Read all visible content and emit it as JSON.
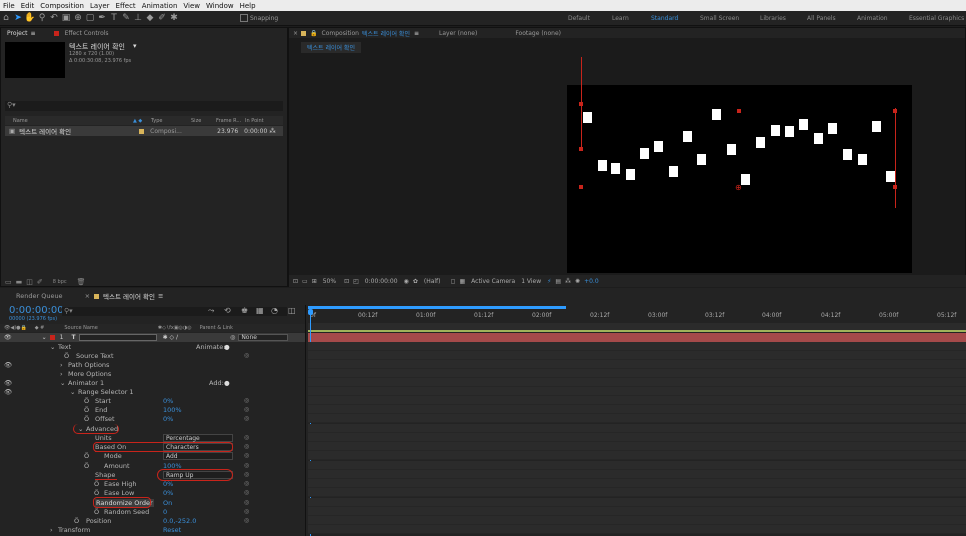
{
  "menu": [
    "File",
    "Edit",
    "Composition",
    "Layer",
    "Effect",
    "Animation",
    "View",
    "Window",
    "Help"
  ],
  "toolbar": {
    "snapping": "Snapping"
  },
  "workspaces": [
    "Default",
    "Learn",
    "Standard",
    "Small Screen",
    "Libraries",
    "All Panels",
    "Animation",
    "Essential Graphics"
  ],
  "project": {
    "tab": "Project",
    "effect_tab": "Effect Controls",
    "comp_name": "텍스트 레이어 확인",
    "comp_size": "1280 x 720 (1.00)",
    "comp_dur": "Δ 0:00:30:08, 23.976 fps",
    "cols": [
      "Name",
      "Type",
      "Size",
      "Frame R...",
      "In Point"
    ],
    "item": {
      "name": "텍스트 레이어 확인",
      "type": "Composi...",
      "fps": "23.976",
      "in": "0:00:00"
    },
    "bpc": "8 bpc"
  },
  "viewer": {
    "tab_prefix": "Composition",
    "tab_name": "텍스트 레이어 확인",
    "layer_tab": "Layer (none)",
    "footage_tab": "Footage (none)",
    "crumb": "텍스트 레이어 확인",
    "zoom": "50%",
    "time": "0:00:00:00",
    "res": "(Half)",
    "camera": "Active Camera",
    "views": "1 View",
    "exposure": "+0.0"
  },
  "timeline": {
    "render_queue": "Render Queue",
    "comp_tab": "텍스트 레이어 확인",
    "time": "0:00:00:00",
    "frames": "00000 (23.976 fps)",
    "search": "",
    "col_source": "Source Name",
    "col_parent": "Parent & Link",
    "layer_num": "1",
    "parent": "None",
    "ruler": [
      "0f",
      "00:12f",
      "01:00f",
      "01:12f",
      "02:00f",
      "02:12f",
      "03:00f",
      "03:12f",
      "04:00f",
      "04:12f",
      "05:00f",
      "05:12f"
    ],
    "props": {
      "text": "Text",
      "animate": "Animate:",
      "source_text": "Source Text",
      "path_options": "Path Options",
      "more_options": "More Options",
      "animator": "Animator 1",
      "add": "Add:",
      "range_selector": "Range Selector 1",
      "start": "Start",
      "start_v": "0%",
      "end": "End",
      "end_v": "100%",
      "offset": "Offset",
      "offset_v": "0%",
      "advanced": "Advanced",
      "units": "Units",
      "units_v": "Percentage",
      "based_on": "Based On",
      "based_on_v": "Characters",
      "mode": "Mode",
      "mode_v": "Add",
      "amount": "Amount",
      "amount_v": "100%",
      "shape": "Shape",
      "shape_v": "Ramp Up",
      "ease_high": "Ease High",
      "ease_high_v": "0%",
      "ease_low": "Ease Low",
      "ease_low_v": "0%",
      "randomize": "Randomize Order",
      "randomize_v": "On",
      "random_seed": "Random Seed",
      "random_seed_v": "0",
      "position": "Position",
      "position_v": "0.0,-252.0",
      "transform": "Transform",
      "reset": "Reset"
    }
  }
}
